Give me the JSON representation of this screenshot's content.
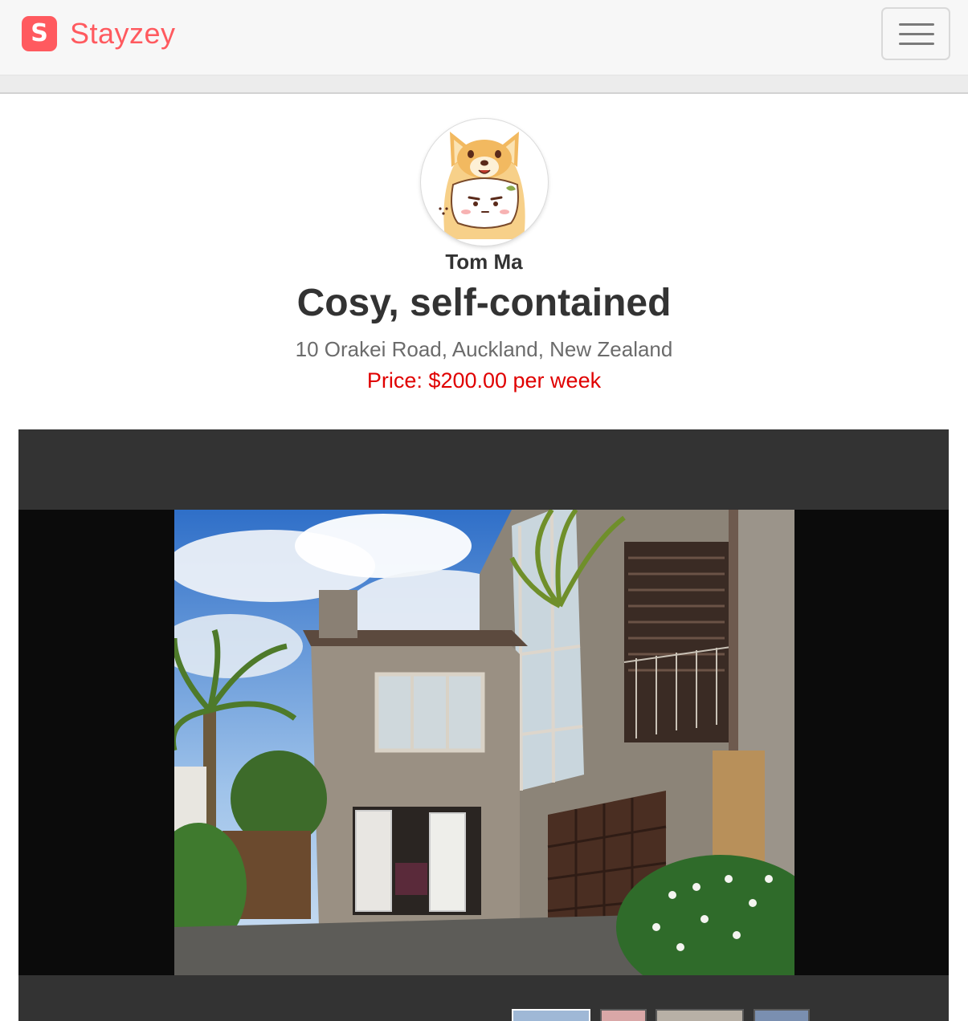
{
  "navbar": {
    "brand_logo_letter": "S",
    "brand_name": "Stayzey",
    "menu_icon": "hamburger-menu-icon",
    "brand_color": "#ff5a5f"
  },
  "host": {
    "name": "Tom Ma",
    "avatar_icon": "shiba-dog-avatar"
  },
  "listing": {
    "title": "Cosy, self-contained",
    "address": "10 Orakei Road, Auckland, New Zealand",
    "price": "Price: $200.00 per week",
    "price_color": "#e00000"
  },
  "gallery": {
    "thumbnail_count": 4,
    "active_thumbnail": 1
  }
}
